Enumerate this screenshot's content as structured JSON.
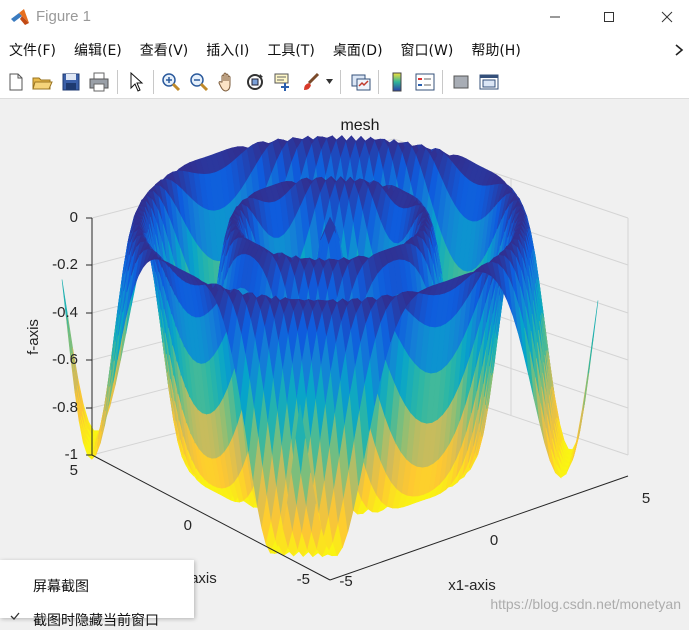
{
  "window": {
    "title": "Figure 1",
    "minimize_icon": "minimize-icon",
    "maximize_icon": "maximize-icon",
    "close_icon": "close-icon"
  },
  "menu": {
    "items": [
      "文件(F)",
      "编辑(E)",
      "查看(V)",
      "插入(I)",
      "工具(T)",
      "桌面(D)",
      "窗口(W)",
      "帮助(H)"
    ],
    "overflow_icon": "chevron-right-icon"
  },
  "toolbar": {
    "icons": [
      "new-figure-icon",
      "open-file-icon",
      "save-icon",
      "print-icon",
      "pointer-icon",
      "zoom-in-icon",
      "zoom-out-icon",
      "pan-hand-icon",
      "rotate-3d-icon",
      "data-cursor-icon",
      "brush-icon",
      "brush-dropdown-icon",
      "link-plot-icon",
      "colorbar-icon",
      "legend-icon",
      "hide-plot-tools-icon",
      "show-plot-tools-icon"
    ]
  },
  "plot": {
    "title": "mesh",
    "zlabel": "f-axis",
    "xlabel": "x1-axis",
    "ylabel": "x2-axis",
    "z_ticks": [
      "0",
      "-0.2",
      "-0.4",
      "-0.6",
      "-0.8",
      "-1"
    ],
    "x_ticks": [
      "-5",
      "0",
      "5"
    ],
    "y_ticks": [
      "5",
      "0",
      "-5"
    ],
    "colormap": [
      "#352a87",
      "#0f5cdd",
      "#1481d6",
      "#06a4ca",
      "#2eb7a4",
      "#87bf77",
      "#d1bb59",
      "#fec832",
      "#f9fb0e"
    ]
  },
  "context_menu": {
    "items": [
      "屏幕截图",
      "截图时隐藏当前窗口"
    ]
  },
  "watermark": "https://blog.csdn.net/monetyan"
}
